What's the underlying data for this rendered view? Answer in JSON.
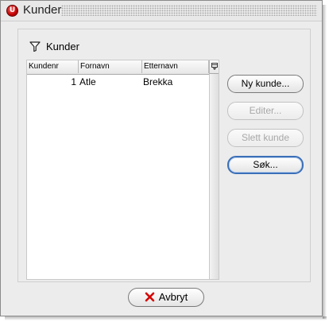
{
  "window": {
    "title": "Kunder",
    "app_icon_letter": "U"
  },
  "group": {
    "label": "Kunder",
    "icon": "filter-icon"
  },
  "table": {
    "columns": [
      "Kundenr",
      "Fornavn",
      "Etternavn"
    ],
    "rows": [
      {
        "kundenr": "1",
        "fornavn": "Atle",
        "etternavn": "Brekka"
      }
    ],
    "column_chooser_icon": "column-chooser-icon"
  },
  "buttons": {
    "new_customer": "Ny kunde...",
    "edit": "Editer...",
    "delete_customer": "Slett kunde",
    "search": "Søk..."
  },
  "cancel": {
    "label": "Avbryt",
    "icon": "close-icon",
    "icon_color": "#d40000"
  }
}
